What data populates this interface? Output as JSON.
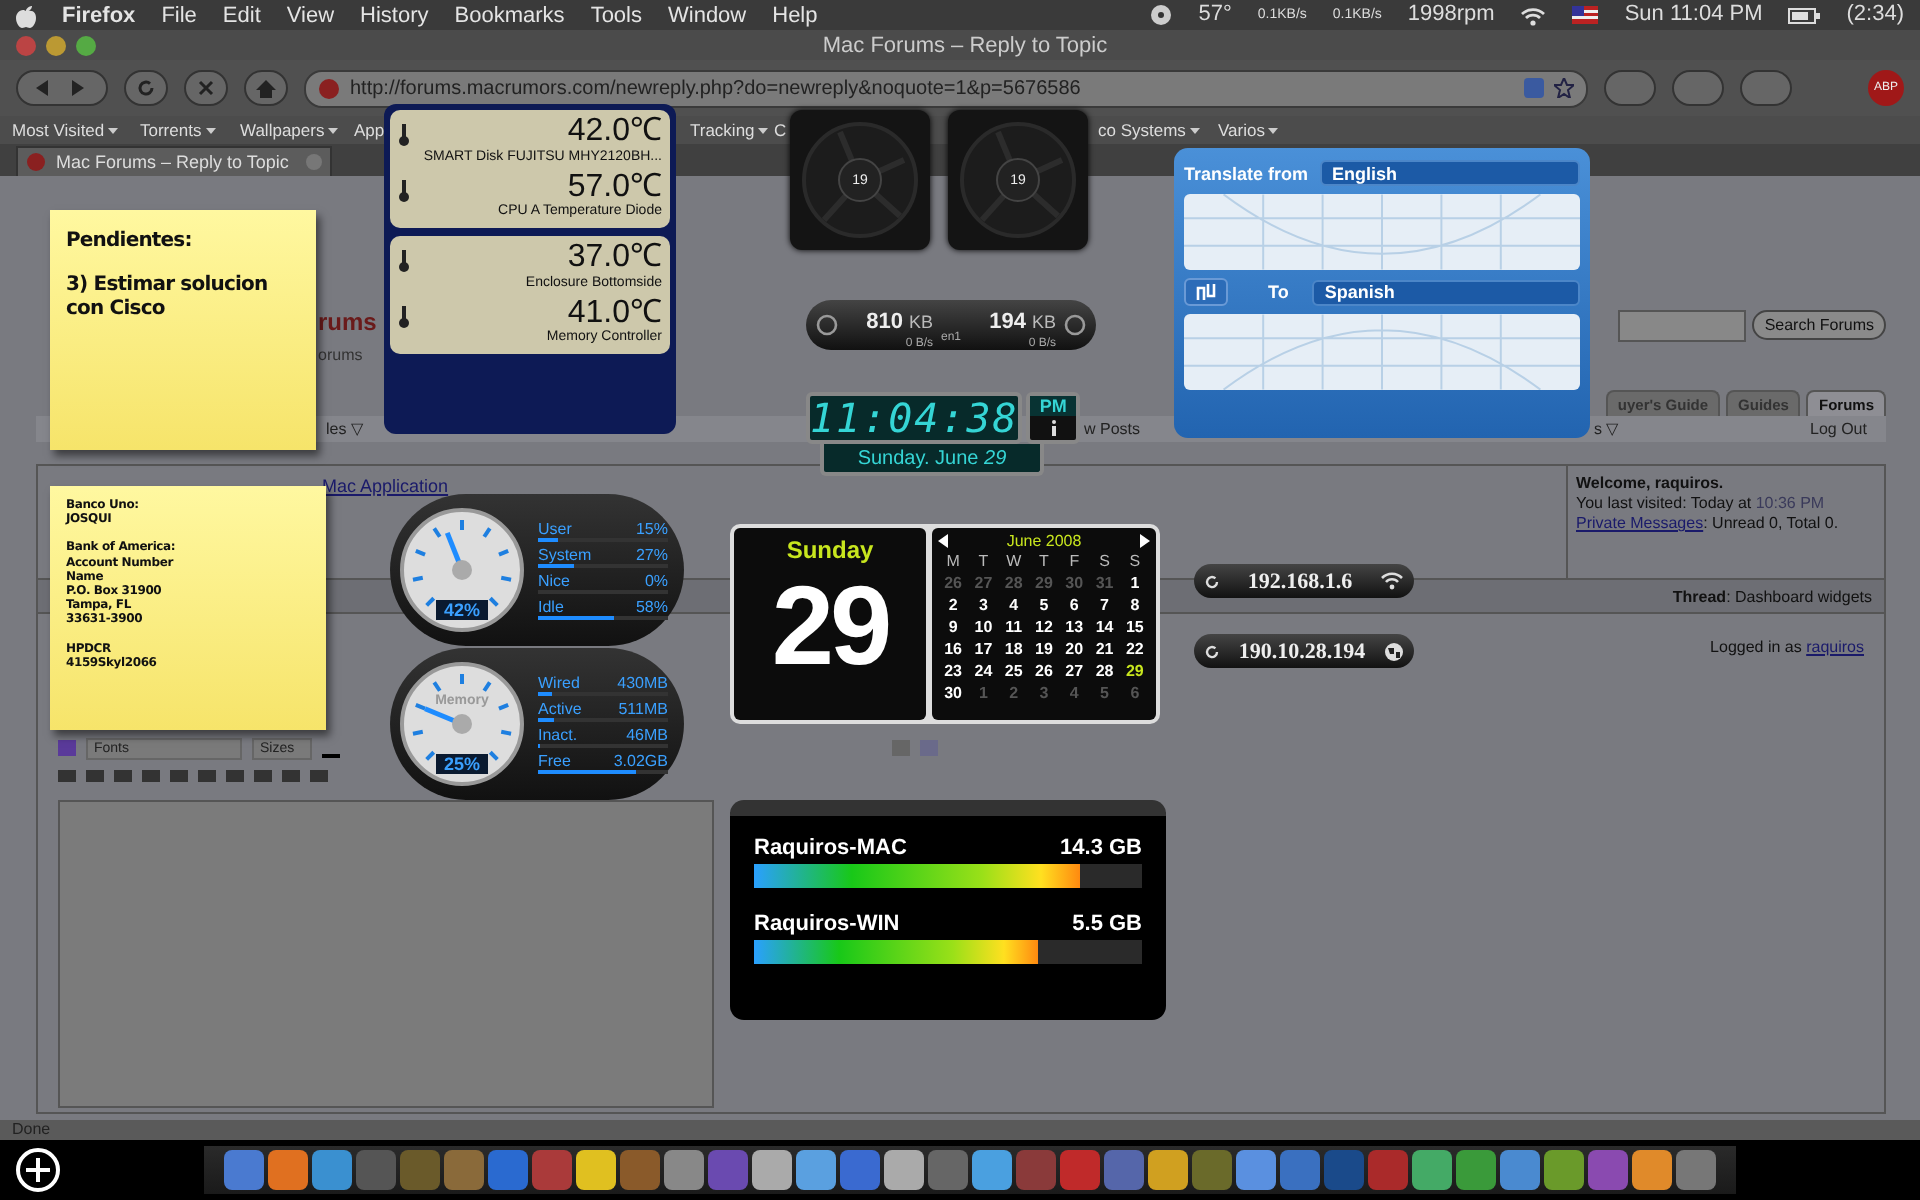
{
  "menu_bar": {
    "app": "Firefox",
    "menus": [
      "File",
      "Edit",
      "View",
      "History",
      "Bookmarks",
      "Tools",
      "Window",
      "Help"
    ],
    "status": {
      "temperature": "57°",
      "net_up": "0.1KB/s",
      "net_down": "0.1KB/s",
      "fan_speed": "1998rpm",
      "clock": "Sun 11:04 PM",
      "battery": "(2:34)"
    }
  },
  "browser": {
    "title": "Mac Forums – Reply to Topic",
    "url": "http://forums.macrumors.com/newreply.php?do=newreply&noquote=1&p=5676586",
    "adblock_label": "ABP",
    "bookmarks": [
      {
        "label": "Most Visited",
        "caret": true
      },
      {
        "label": "Torrents",
        "caret": true
      },
      {
        "label": "Wallpapers",
        "caret": true
      },
      {
        "label": "App",
        "caret": false
      },
      {
        "label": "Tracking",
        "caret": true
      },
      {
        "label": "C",
        "caret": false
      },
      {
        "label": "co Systems",
        "caret": true
      },
      {
        "label": "Varios",
        "caret": true
      }
    ],
    "tabs": [
      {
        "label": "Mac Forums – Reply to Topic",
        "selected": true
      }
    ],
    "page": {
      "logo": "rums",
      "logo_subtitle": "orums",
      "search_button": "Search Forums",
      "tabs": [
        {
          "label": "uyer's Guide",
          "selected": false
        },
        {
          "label": "Guides",
          "selected": false
        },
        {
          "label": "Forums",
          "selected": true
        }
      ],
      "nav": [
        "les ▽",
        "w Posts",
        "s ▽",
        "Log Out"
      ],
      "link": "Mac Application",
      "welcome": {
        "title": "Welcome, raquiros.",
        "last_visited": "You last visited: Today at ",
        "last_visited_time": "10:36 PM",
        "pm_link": "Private Messages",
        "pm_counts": ": Unread 0, Total 0."
      },
      "thread": "**Thread**: Dashboard widgets",
      "logged_in": "Logged in as ",
      "user_link": "raquiros",
      "editor": {
        "font": "Fonts",
        "size": "Sizes"
      }
    },
    "status": "Done"
  },
  "widgets": {
    "notes": [
      {
        "paragraphs": [
          "Pendientes:",
          "3) Estimar solucion con Cisco"
        ]
      },
      {
        "paragraphs": [
          "Banco Uno:\nJOSQUI",
          "Bank of America:\nAccount Number\nName\nP.O. Box 31900\nTampa, FL\n33631-3900",
          "HPDCR\n4159Skyl2066"
        ]
      }
    ],
    "temperature": [
      {
        "sensors": [
          {
            "value": "42.0℃",
            "name": "SMART Disk FUJITSU MHY2120BH..."
          },
          {
            "value": "57.0℃",
            "name": "CPU A Temperature Diode"
          }
        ]
      },
      {
        "sensors": [
          {
            "value": "37.0℃",
            "name": "Enclosure Bottomside"
          },
          {
            "value": "41.0℃",
            "name": "Memory Controller"
          }
        ]
      }
    ],
    "fans": [
      {
        "label": "19"
      },
      {
        "label": "19"
      }
    ],
    "network": {
      "received": "810",
      "received_unit": "KB",
      "sent": "194",
      "sent_unit": "KB",
      "in_rate": "0 B/s",
      "interface": "en1",
      "out_rate": "0 B/s"
    },
    "clock": {
      "time": "11:04:38",
      "period": "PM",
      "date": "Sunday. June *29*"
    },
    "cpu": {
      "percent": "42%",
      "level": 0.42,
      "rows": [
        {
          "label": "User",
          "value": "15%",
          "level": 0.15
        },
        {
          "label": "System",
          "value": "27%",
          "level": 0.27
        },
        {
          "label": "Nice",
          "value": "0%",
          "level": 0
        },
        {
          "label": "Idle",
          "value": "58%",
          "level": 0.58
        }
      ]
    },
    "memory": {
      "gauge_label": "Memory",
      "percent": "25%",
      "level": 0.25,
      "rows": [
        {
          "label": "Wired",
          "value": "430MB",
          "level": 0.1
        },
        {
          "label": "Active",
          "value": "511MB",
          "level": 0.12
        },
        {
          "label": "Inact.",
          "value": "46MB",
          "level": 0.02
        },
        {
          "label": "Free",
          "value": "3.02GB",
          "level": 0.75
        }
      ]
    },
    "calendar": {
      "weekday": "Sunday",
      "day": "29",
      "month": "June 2008",
      "weekdays": [
        "M",
        "T",
        "W",
        "T",
        "F",
        "S",
        "S"
      ],
      "days": [
        {
          "day": "26",
          "in_month": false,
          "selected": false
        },
        {
          "day": "27",
          "in_month": false,
          "selected": false
        },
        {
          "day": "28",
          "in_month": false,
          "selected": false
        },
        {
          "day": "29",
          "in_month": false,
          "selected": false
        },
        {
          "day": "30",
          "in_month": false,
          "selected": false
        },
        {
          "day": "31",
          "in_month": false,
          "selected": false
        },
        {
          "day": "1",
          "in_month": true,
          "selected": false
        },
        {
          "day": "2",
          "in_month": true,
          "selected": false
        },
        {
          "day": "3",
          "in_month": true,
          "selected": false
        },
        {
          "day": "4",
          "in_month": true,
          "selected": false
        },
        {
          "day": "5",
          "in_month": true,
          "selected": false
        },
        {
          "day": "6",
          "in_month": true,
          "selected": false
        },
        {
          "day": "7",
          "in_month": true,
          "selected": false
        },
        {
          "day": "8",
          "in_month": true,
          "selected": false
        },
        {
          "day": "9",
          "in_month": true,
          "selected": false
        },
        {
          "day": "10",
          "in_month": true,
          "selected": false
        },
        {
          "day": "11",
          "in_month": true,
          "selected": false
        },
        {
          "day": "12",
          "in_month": true,
          "selected": false
        },
        {
          "day": "13",
          "in_month": true,
          "selected": false
        },
        {
          "day": "14",
          "in_month": true,
          "selected": false
        },
        {
          "day": "15",
          "in_month": true,
          "selected": false
        },
        {
          "day": "16",
          "in_month": true,
          "selected": false
        },
        {
          "day": "17",
          "in_month": true,
          "selected": false
        },
        {
          "day": "18",
          "in_month": true,
          "selected": false
        },
        {
          "day": "19",
          "in_month": true,
          "selected": false
        },
        {
          "day": "20",
          "in_month": true,
          "selected": false
        },
        {
          "day": "21",
          "in_month": true,
          "selected": false
        },
        {
          "day": "22",
          "in_month": true,
          "selected": false
        },
        {
          "day": "23",
          "in_month": true,
          "selected": false
        },
        {
          "day": "24",
          "in_month": true,
          "selected": false
        },
        {
          "day": "25",
          "in_month": true,
          "selected": false
        },
        {
          "day": "26",
          "in_month": true,
          "selected": false
        },
        {
          "day": "27",
          "in_month": true,
          "selected": false
        },
        {
          "day": "28",
          "in_month": true,
          "selected": false
        },
        {
          "day": "29",
          "in_month": true,
          "selected": true
        },
        {
          "day": "30",
          "in_month": true,
          "selected": false
        },
        {
          "day": "1",
          "in_month": false,
          "selected": false
        },
        {
          "day": "2",
          "in_month": false,
          "selected": false
        },
        {
          "day": "3",
          "in_month": false,
          "selected": false
        },
        {
          "day": "4",
          "in_month": false,
          "selected": false
        },
        {
          "day": "5",
          "in_month": false,
          "selected": false
        },
        {
          "day": "6",
          "in_month": false,
          "selected": false
        }
      ]
    },
    "ip": [
      {
        "address": "192.168.1.6",
        "kind": "local"
      },
      {
        "address": "190.10.28.194",
        "kind": "public"
      }
    ],
    "translate": {
      "from_label": "Translate from",
      "from": "English",
      "to_label": "To",
      "to": "Spanish"
    },
    "disks": [
      {
        "name": "Raquiros-MAC",
        "used": "14.3 GB",
        "level": 0.84
      },
      {
        "name": "Raquiros-WIN",
        "used": "5.5 GB",
        "level": 0.73
      }
    ]
  }
}
